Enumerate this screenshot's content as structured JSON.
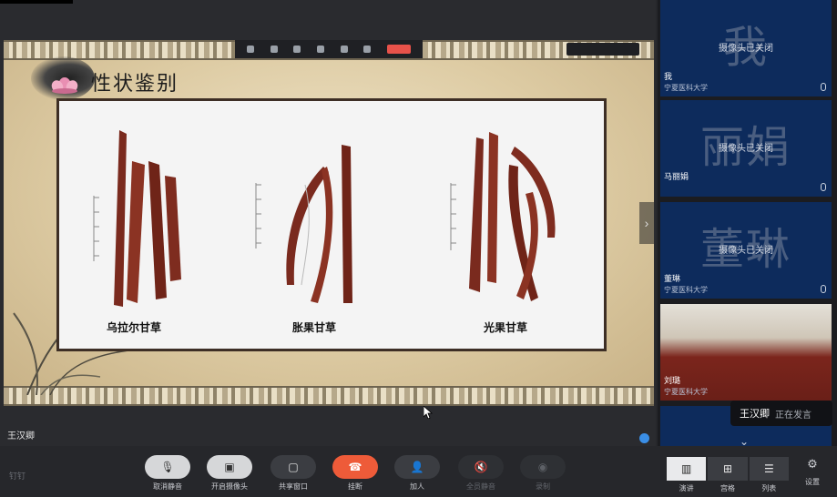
{
  "slide": {
    "title": "性状鉴别",
    "herbs": [
      {
        "label": "乌拉尔甘草"
      },
      {
        "label": "胀果甘草"
      },
      {
        "label": "光果甘草"
      }
    ]
  },
  "speaker": {
    "name": "王汉卿"
  },
  "participants": [
    {
      "big_text": "我",
      "status": "摄像头已关闭",
      "name": "我",
      "org": "宁夏医科大学"
    },
    {
      "big_text": "丽娟",
      "status": "摄像头已关闭",
      "name": "马丽娟",
      "org": ""
    },
    {
      "big_text": "董琳",
      "status": "摄像头已关闭",
      "name": "董琳",
      "org": "宁夏医科大学"
    },
    {
      "big_text": "",
      "status": "",
      "name": "刘璐",
      "org": "宁夏医科大学"
    }
  ],
  "speaking_tooltip": {
    "name": "王汉卿",
    "status": "正在发言"
  },
  "toolbar": {
    "brand": "钉钉",
    "unmute_label": "取消静音",
    "camera_label": "开启摄像头",
    "share_label": "共享窗口",
    "hangup_label": "挂断",
    "add_label": "加人",
    "mute_all_label": "全员静音",
    "record_label": "录制",
    "view_speaker_label": "演讲",
    "view_grid_label": "宫格",
    "view_list_label": "列表",
    "settings_label": "设置"
  },
  "colors": {
    "tile_bg": "#0d2b5c",
    "hangup": "#ee5b39",
    "bar_bg": "#26272b"
  }
}
